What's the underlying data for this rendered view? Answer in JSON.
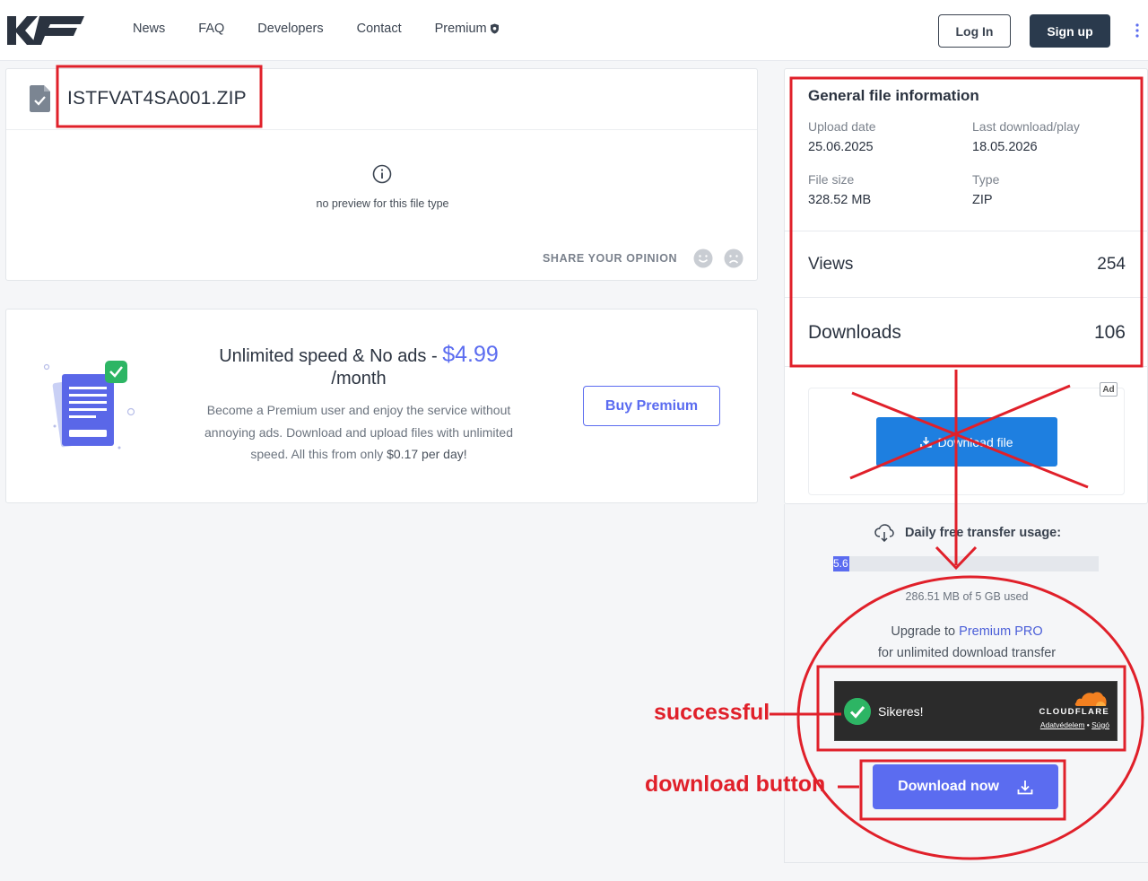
{
  "header": {
    "nav": [
      "News",
      "FAQ",
      "Developers",
      "Contact",
      "Premium"
    ],
    "login_label": "Log In",
    "signup_label": "Sign up"
  },
  "file": {
    "name": "ISTFVAT4SA001.ZIP",
    "no_preview": "no preview for this file type",
    "share_label": "SHARE YOUR OPINION"
  },
  "promo": {
    "title_part1": "Unlimited speed & No ads - ",
    "price": "$4.99",
    "per": "/month",
    "desc_part1": "Become a Premium user and enjoy the service without annoying ads. Download and upload files with unlimited speed. All this from only ",
    "desc_highlight": "$0.17 per day!",
    "buy_label": "Buy Premium"
  },
  "info": {
    "title": "General file information",
    "upload_label": "Upload date",
    "upload_value": "25.06.2025",
    "last_label": "Last download/play",
    "last_value": "18.05.2026",
    "size_label": "File size",
    "size_value": "328.52 MB",
    "type_label": "Type",
    "type_value": "ZIP",
    "views_label": "Views",
    "views_value": "254",
    "downloads_label": "Downloads",
    "downloads_value": "106"
  },
  "ad": {
    "tag": "Ad",
    "download_file_label": "Download file"
  },
  "transfer": {
    "title": "Daily free transfer usage:",
    "bar_label": "5.6",
    "bar_fraction": 0.056,
    "used": "286.51 MB of 5 GB used",
    "upgrade_prefix": "Upgrade to ",
    "upgrade_link": "Premium PRO",
    "unlimited": "for unlimited download transfer"
  },
  "captcha": {
    "status": "Sikeres!",
    "logo": "CLOUDFLARE",
    "link1": "Adatvédelem",
    "sep": " • ",
    "link2": "Súgó"
  },
  "download_now_label": "Download now",
  "annotations": {
    "successful": "successful",
    "download_button": "download button"
  },
  "colors": {
    "accent": "#5b6cf0",
    "annotation_red": "#e0202a",
    "dark_navy": "#2a3a4d"
  }
}
